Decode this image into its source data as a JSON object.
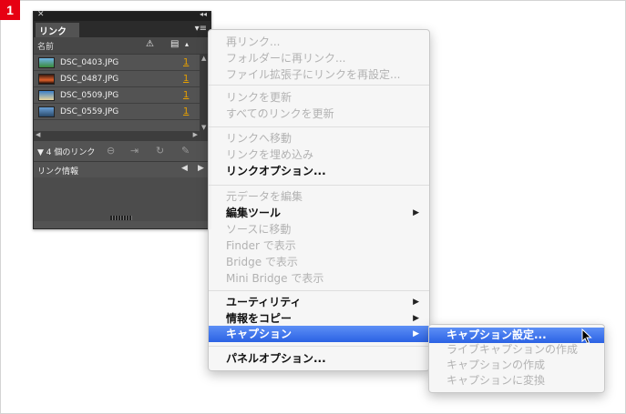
{
  "step_badge": "1",
  "panel": {
    "close_glyph": "✕",
    "collapse_glyph": "◂◂",
    "tab_label": "リンク",
    "menu_glyph": "▾≡",
    "columns": {
      "name": "名前",
      "warning_icon": "warning-icon",
      "page_icon": "page-icon",
      "sort_glyph": "▴"
    },
    "rows": [
      {
        "name": "DSC_0403.JPG",
        "page": "1"
      },
      {
        "name": "DSC_0487.JPG",
        "page": "1"
      },
      {
        "name": "DSC_0509.JPG",
        "page": "1"
      },
      {
        "name": "DSC_0559.JPG",
        "page": "1"
      }
    ],
    "link_count": "▼ 4 個のリンク",
    "info_label": "リンク情報",
    "info_prev": "◀",
    "info_next": "▶"
  },
  "context_menu": {
    "items": [
      {
        "label": "再リンク...",
        "enabled": false
      },
      {
        "label": "フォルダーに再リンク...",
        "enabled": false
      },
      {
        "label": "ファイル拡張子にリンクを再設定...",
        "enabled": false
      },
      {
        "label": "リンクを更新",
        "enabled": false
      },
      {
        "label": "すべてのリンクを更新",
        "enabled": false
      },
      {
        "label": "リンクへ移動",
        "enabled": false
      },
      {
        "label": "リンクを埋め込み",
        "enabled": false
      },
      {
        "label": "リンクオプション...",
        "enabled": true
      },
      {
        "label": "元データを編集",
        "enabled": false
      },
      {
        "label": "編集ツール",
        "enabled": true,
        "submenu": true
      },
      {
        "label": "ソースに移動",
        "enabled": false
      },
      {
        "label": "Finder で表示",
        "enabled": false
      },
      {
        "label": "Bridge で表示",
        "enabled": false
      },
      {
        "label": "Mini Bridge で表示",
        "enabled": false
      },
      {
        "label": "ユーティリティ",
        "enabled": true,
        "submenu": true
      },
      {
        "label": "情報をコピー",
        "enabled": true,
        "submenu": true
      },
      {
        "label": "キャプション",
        "enabled": true,
        "submenu": true,
        "highlighted": true
      },
      {
        "label": "パネルオプション...",
        "enabled": true
      }
    ],
    "submenu_arrow": "▶"
  },
  "caption_submenu": {
    "items": [
      {
        "label": "キャプション設定...",
        "highlighted": true
      },
      {
        "label": "ライブキャプションの作成",
        "enabled": false
      },
      {
        "label": "キャプションの作成",
        "enabled": false
      },
      {
        "label": "キャプションに変換",
        "enabled": false
      }
    ]
  },
  "colors": {
    "highlight": "#2b62e4",
    "badge": "#e60012",
    "panel_bg": "#535353"
  }
}
